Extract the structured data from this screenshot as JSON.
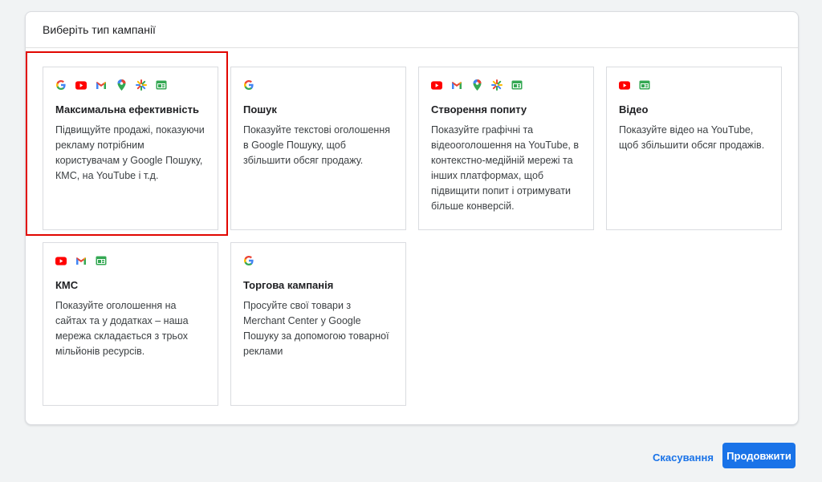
{
  "panel": {
    "title": "Виберіть тип кампанії"
  },
  "cards": [
    {
      "title": "Максимальна ефективність",
      "description": "Підвищуйте продажі, показуючи рекламу потрібним користувачам у Google Пошуку, КМС, на YouTube і т.д.",
      "icons": [
        "google-icon",
        "youtube-icon",
        "gmail-icon",
        "maps-icon",
        "discover-icon",
        "display-icon"
      ],
      "selected": true
    },
    {
      "title": "Пошук",
      "description": "Показуйте текстові оголошення в Google Пошуку, щоб збільшити обсяг продажу.",
      "icons": [
        "google-icon"
      ]
    },
    {
      "title": "Створення попиту",
      "description": "Показуйте графічні та відеооголошення на YouTube, в контекстно-медійній мережі та інших платформах, щоб підвищити попит і отримувати більше конверсій.",
      "icons": [
        "youtube-icon",
        "gmail-icon",
        "maps-icon",
        "discover-icon",
        "display-icon"
      ]
    },
    {
      "title": "Відео",
      "description": "Показуйте відео на YouTube, щоб збільшити обсяг продажів.",
      "icons": [
        "youtube-icon",
        "display-icon"
      ]
    },
    {
      "title": "КМС",
      "description": "Показуйте оголошення на сайтах та у додатках – наша мережа складається з трьох мільйонів ресурсів.",
      "icons": [
        "youtube-icon",
        "gmail-icon",
        "display-icon"
      ]
    },
    {
      "title": "Торгова кампанія",
      "description": "Просуйте свої товари з Merchant Center у Google Пошуку за допомогою товарної реклами",
      "icons": [
        "google-icon"
      ]
    }
  ],
  "footer": {
    "cancel_label": "Скасування",
    "continue_label": "Продовжити"
  },
  "colors": {
    "accent": "#1a73e8",
    "selection_outline": "#e10600"
  }
}
